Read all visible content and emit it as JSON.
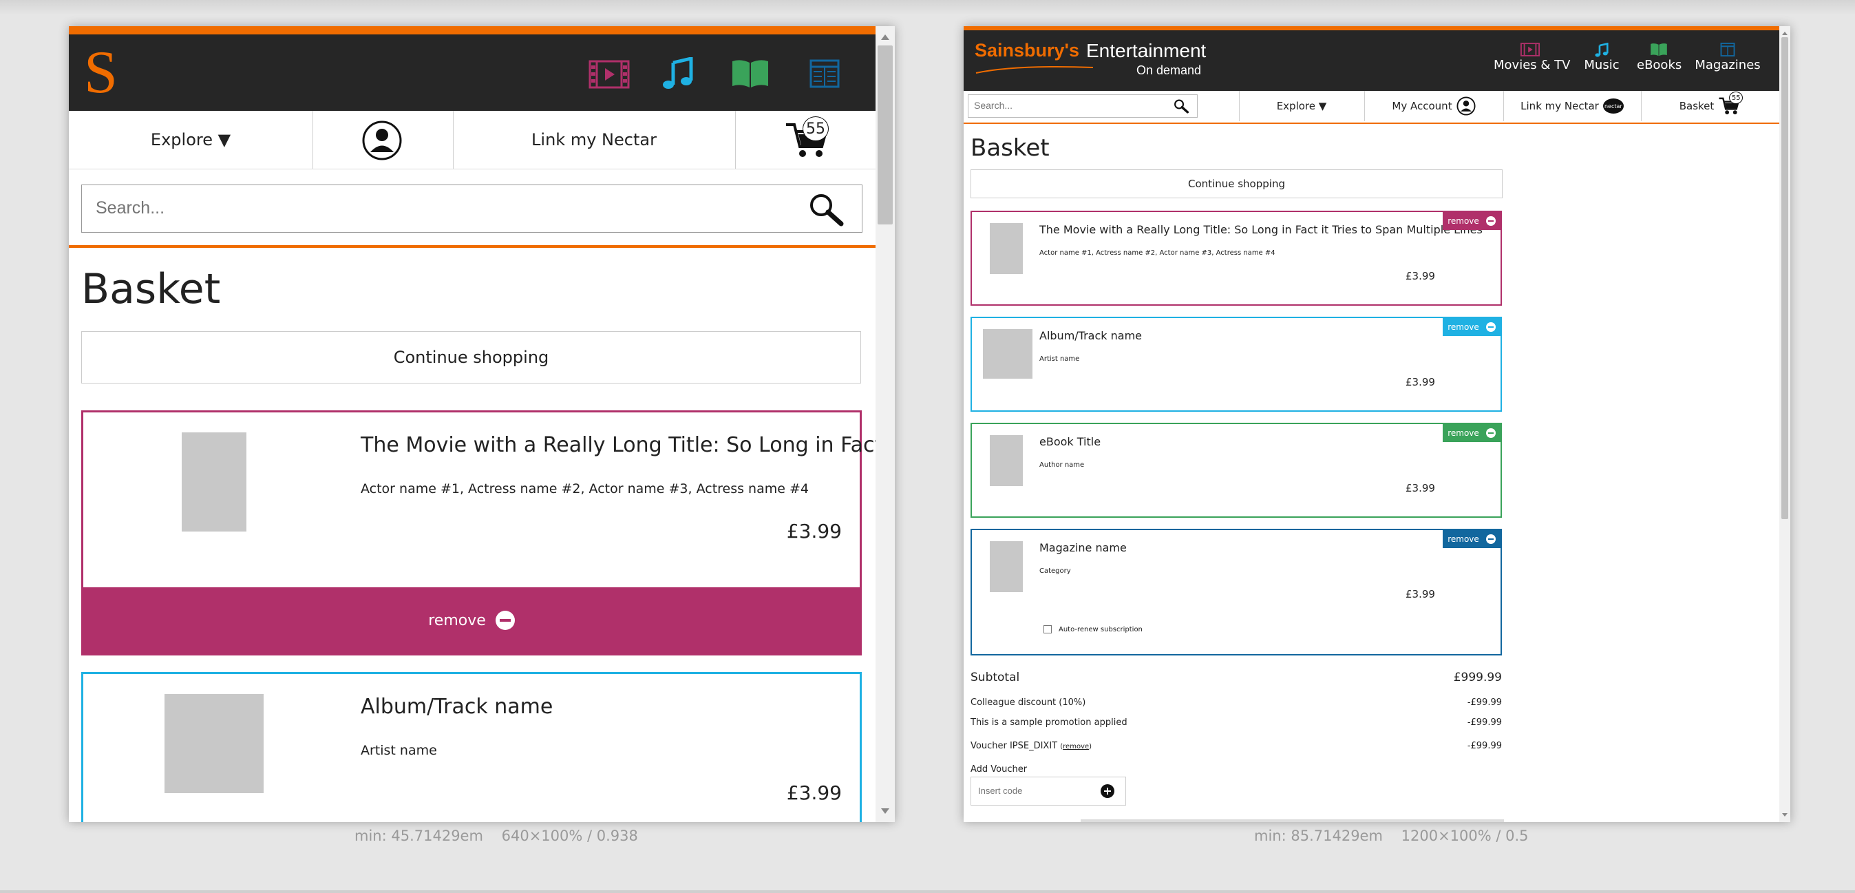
{
  "colors": {
    "orange": "#f06c00",
    "dark": "#262626",
    "movies": "#b0306a",
    "music": "#1fb1e3",
    "ebooks": "#3aa35a",
    "magazines": "#12679e",
    "grey_placeholder": "#c8c8c8"
  },
  "left": {
    "logo": "S",
    "nav_icons": [
      "film-icon",
      "music-note-icon",
      "book-icon",
      "magazine-icon"
    ],
    "nav": {
      "explore": "Explore ▼",
      "nectar": "Link my Nectar",
      "basket_count": "55"
    },
    "search": {
      "placeholder": "Search..."
    },
    "title": "Basket",
    "continue": "Continue shopping",
    "items": [
      {
        "title": "The Movie with a Really Long Title: So Long in Fact it...",
        "subtitle": "Actor name #1, Actress name #2, Actor name #3, Actress name #4",
        "price": "£3.99",
        "remove": "remove"
      },
      {
        "title": "Album/Track name",
        "subtitle": "Artist name",
        "price": "£3.99"
      }
    ],
    "caption": "min: 45.71429em    640×100% / 0.938"
  },
  "right": {
    "brand": {
      "name": "Sainsbury's",
      "entertainment": "Entertainment",
      "on_demand": "On demand"
    },
    "nav": [
      {
        "label": "Movies & TV",
        "icon": "film-icon"
      },
      {
        "label": "Music",
        "icon": "music-note-icon"
      },
      {
        "label": "eBooks",
        "icon": "book-icon"
      },
      {
        "label": "Magazines",
        "icon": "magazine-icon"
      }
    ],
    "search": {
      "placeholder": "Search..."
    },
    "subnav": {
      "explore": "Explore ▼",
      "account": "My Account",
      "nectar": "Link my Nectar",
      "nectar_badge": "nectar",
      "basket": "Basket",
      "basket_count": "55"
    },
    "title": "Basket",
    "continue": "Continue shopping",
    "items": [
      {
        "title": "The Movie with a Really Long Title: So Long in Fact it Tries to Span Multiple Lines",
        "subtitle": "Actor name #1, Actress name #2, Actor name #3, Actress name #4",
        "price": "£3.99",
        "remove": "remove"
      },
      {
        "title": "Album/Track name",
        "subtitle": "Artist name",
        "price": "£3.99",
        "remove": "remove"
      },
      {
        "title": "eBook Title",
        "subtitle": "Author name",
        "price": "£3.99",
        "remove": "remove"
      },
      {
        "title": "Magazine name",
        "subtitle": "Category",
        "price": "£3.99",
        "remove": "remove",
        "auto_renew": "Auto-renew subscription"
      }
    ],
    "summary": {
      "subtotal_label": "Subtotal",
      "subtotal": "£999.99",
      "lines": [
        {
          "label": "Colleague discount (10%)",
          "value": "-£99.99"
        },
        {
          "label": "This is a sample promotion applied",
          "value": "-£99.99"
        },
        {
          "label": "Voucher IPSE_DIXIT",
          "link": "remove",
          "value": "-£99.99"
        }
      ],
      "add_voucher": "Add Voucher",
      "voucher_placeholder": "Insert code"
    },
    "caption": "min: 85.71429em    1200×100% / 0.5"
  }
}
